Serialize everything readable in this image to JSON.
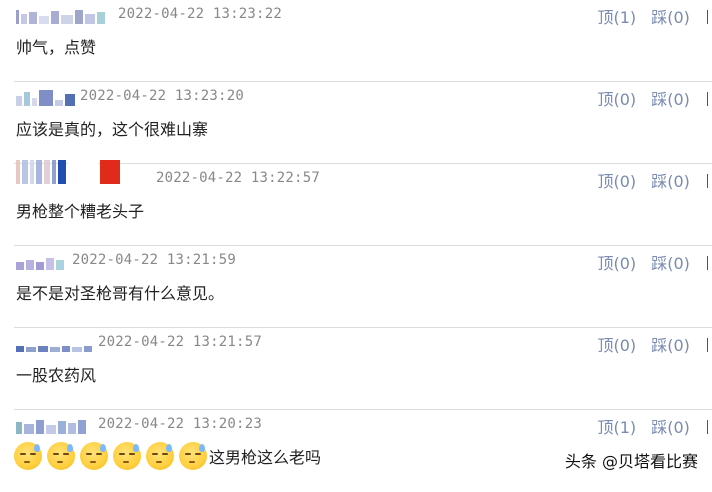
{
  "comments": [
    {
      "timestamp": "2022-04-22 13:23:22",
      "text": "帅气，点赞",
      "up": "顶(1)",
      "down": "踩(0)"
    },
    {
      "timestamp": "2022-04-22 13:23:20",
      "text": "应该是真的，这个很难山寨",
      "up": "顶(0)",
      "down": "踩(0)"
    },
    {
      "timestamp": "2022-04-22 13:22:57",
      "text": "男枪整个糟老头子",
      "up": "顶(0)",
      "down": "踩(0)"
    },
    {
      "timestamp": "2022-04-22 13:21:59",
      "text": "是不是对圣枪哥有什么意见。",
      "up": "顶(0)",
      "down": "踩(0)"
    },
    {
      "timestamp": "2022-04-22 13:21:57",
      "text": "一股农药风",
      "up": "顶(0)",
      "down": "踩(0)"
    },
    {
      "timestamp": "2022-04-22 13:20:23",
      "text": "这男枪这么老吗",
      "up": "顶(1)",
      "down": "踩(0)"
    }
  ],
  "watermark": "头条 @贝塔看比赛"
}
